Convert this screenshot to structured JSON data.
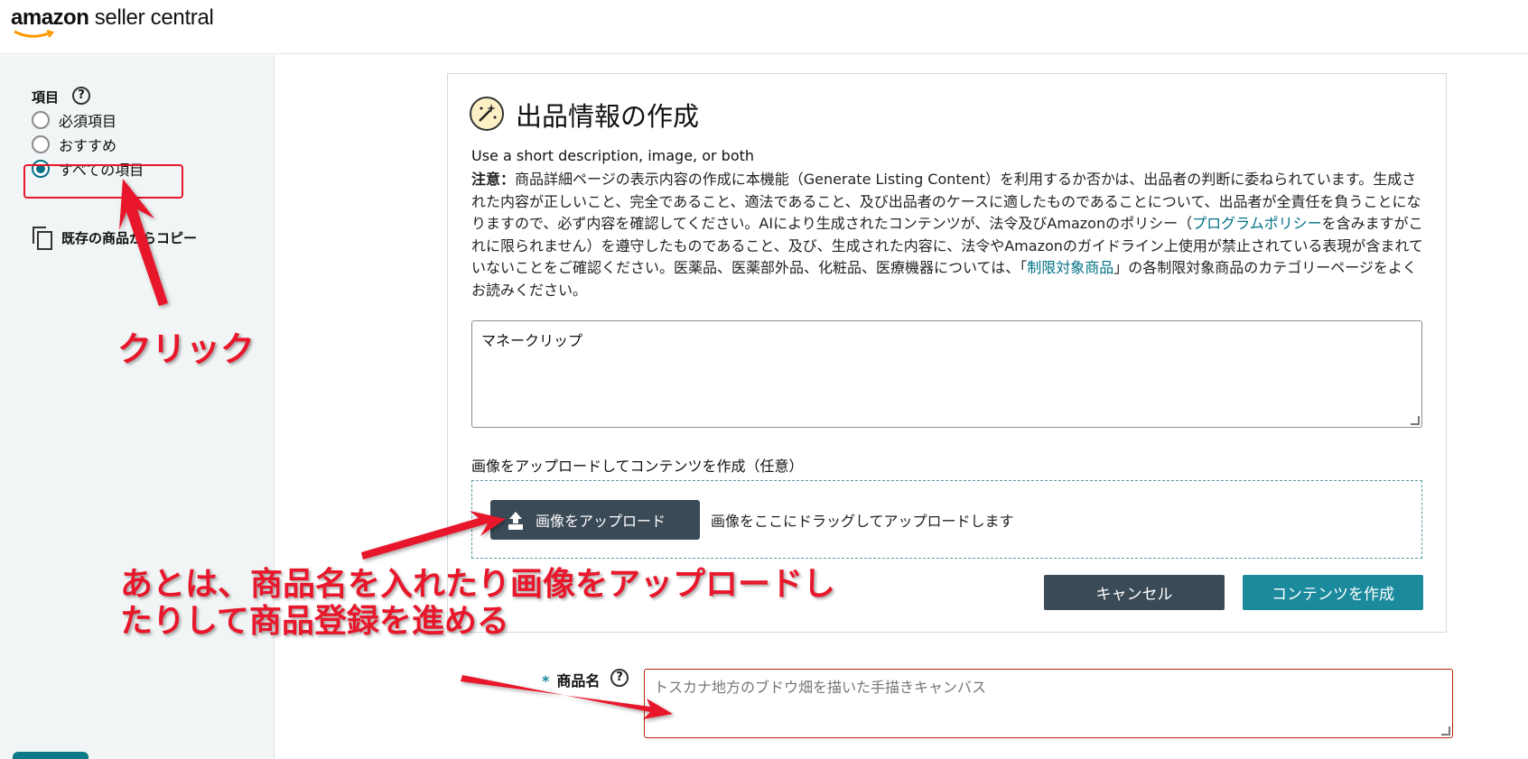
{
  "header": {
    "logo_brand": "amazon",
    "logo_rest": " seller central"
  },
  "sidebar": {
    "title": "項目",
    "options": [
      {
        "label": "必須項目",
        "selected": false
      },
      {
        "label": "おすすめ",
        "selected": false
      },
      {
        "label": "すべての項目",
        "selected": true
      }
    ],
    "copy_label": "既存の商品からコピー"
  },
  "main": {
    "title": "出品情報の作成",
    "subtitle": "Use a short description, image, or both",
    "notice_bold": "注意：",
    "notice_text_1": "商品詳細ページの表示内容の作成に本機能（Generate Listing Content）を利用するか否かは、出品者の判断に委ねられています。生成された内容が正しいこと、完全であること、適法であること、及び出品者のケースに適したものであることについて、出品者が全責任を負うことになりますので、必ず内容を確認してください。AIにより生成されたコンテンツが、法令及びAmazonのポリシー（",
    "notice_link_1": "プログラムポリシー",
    "notice_text_2": "を含みますがこれに限られません）を遵守したものであること、及び、生成された内容に、法令やAmazonのガイドライン上使用が禁止されている表現が含まれていないことをご確認ください。医薬品、医薬部外品、化粧品、医療機器については、「",
    "notice_link_2": "制限対象商品",
    "notice_text_3": "」の各制限対象商品のカテゴリーページをよくお読みください。",
    "description_value": "マネークリップ",
    "upload_label": "画像をアップロードしてコンテンツを作成（任意）",
    "upload_button": "画像をアップロード",
    "drop_text": "画像をここにドラッグしてアップロードします",
    "cancel_button": "キャンセル",
    "create_button": "コンテンツを作成"
  },
  "product_name": {
    "required_mark": "*",
    "label": "商品名",
    "placeholder": "トスカナ地方のブドウ畑を描いた手描きキャンバス"
  },
  "annotations": {
    "click": "クリック",
    "note_line1": "あとは、商品名を入れたり画像をアップロードし",
    "note_line2": "たりして商品登録を進める",
    "color": "#e8172b"
  },
  "colors": {
    "accent": "#1a8a9c",
    "dark_button": "#3b4a57",
    "link": "#007185"
  },
  "icons": [
    "help-icon",
    "copy-icon",
    "magic-wand-icon",
    "upload-icon"
  ]
}
